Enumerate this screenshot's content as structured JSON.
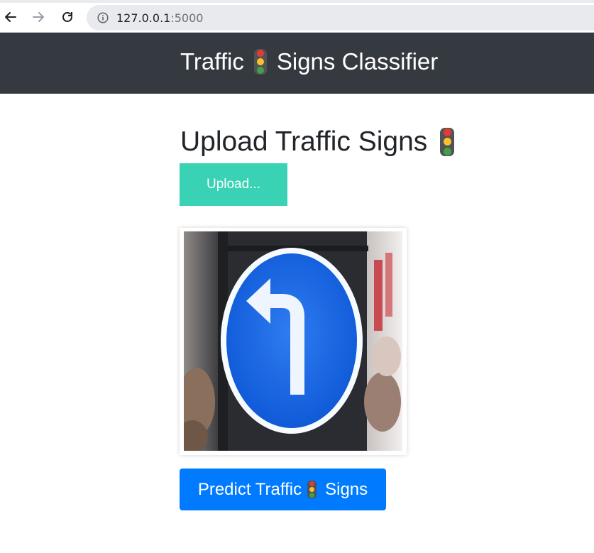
{
  "browser": {
    "url_host": "127.0.0.1",
    "url_port": ":5000"
  },
  "navbar": {
    "brand_part1": "Traffic",
    "brand_part2": "Signs Classifier"
  },
  "main": {
    "title": "Upload Traffic Signs",
    "upload_label": "Upload...",
    "predict_part1": "Predict Traffic",
    "predict_part2": "Signs"
  },
  "icons": {
    "traffic_light": "traffic-light-icon",
    "back": "arrow-left-icon",
    "forward": "arrow-right-icon",
    "reload": "reload-icon",
    "info": "info-icon"
  },
  "colors": {
    "navbar_bg": "#343a40",
    "upload_button": "#39d2b4",
    "predict_button": "#007bff",
    "sign_blue": "#1466e0"
  }
}
